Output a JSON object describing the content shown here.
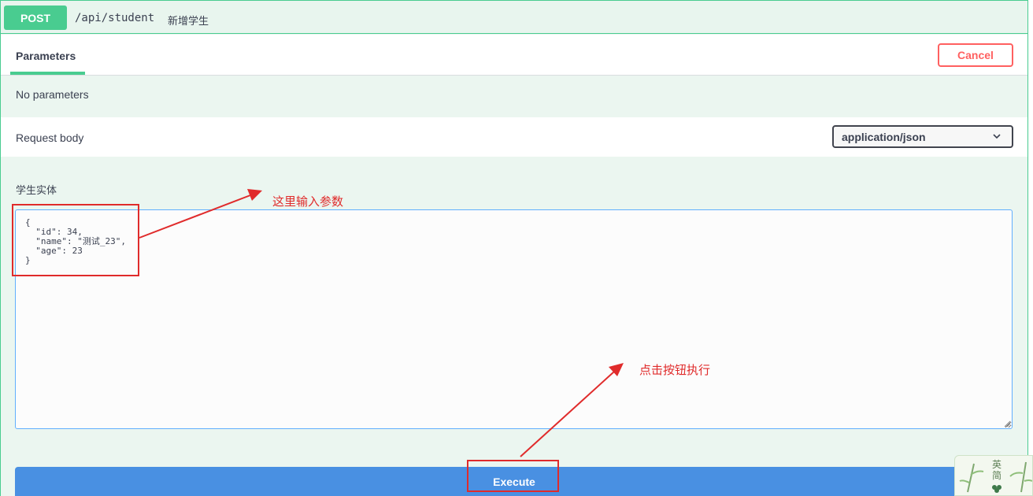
{
  "operation": {
    "method": "POST",
    "path": "/api/student",
    "summary": "新增学生"
  },
  "tabs": {
    "parameters_label": "Parameters",
    "cancel_label": "Cancel"
  },
  "parameters": {
    "empty_text": "No parameters"
  },
  "request_body": {
    "label": "Request body",
    "content_type": "application/json",
    "entity_label": "学生实体",
    "value": "{\n  \"id\": 34,\n  \"name\": \"测试_23\",\n  \"age\": 23\n}"
  },
  "execute_label": "Execute",
  "annotations": {
    "input_hint": "这里输入参数",
    "click_hint": "点击按钮执行"
  },
  "widget": {
    "line1": "英",
    "line2": "简"
  },
  "colors": {
    "post_green": "#49cc90",
    "execute_blue": "#4990e2",
    "cancel_red": "#ff6060",
    "annotation_red": "#e02b2b"
  }
}
